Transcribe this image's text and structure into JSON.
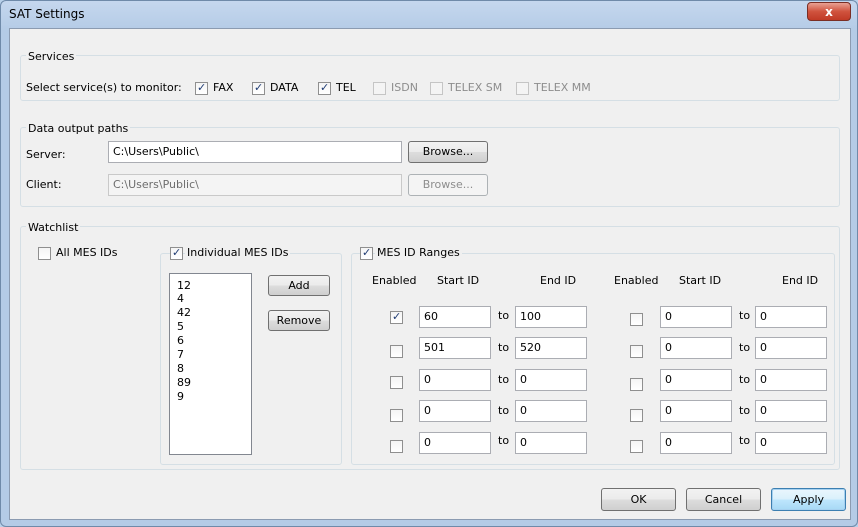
{
  "window": {
    "title": "SAT Settings",
    "close_glyph": "x"
  },
  "services": {
    "group_label": "Services",
    "select_label": "Select service(s) to monitor:",
    "items": [
      {
        "label": "FAX",
        "checked": true,
        "enabled": true
      },
      {
        "label": "DATA",
        "checked": true,
        "enabled": true
      },
      {
        "label": "TEL",
        "checked": true,
        "enabled": true
      },
      {
        "label": "ISDN",
        "checked": false,
        "enabled": false
      },
      {
        "label": "TELEX SM",
        "checked": false,
        "enabled": false
      },
      {
        "label": "TELEX MM",
        "checked": false,
        "enabled": false
      }
    ]
  },
  "paths": {
    "group_label": "Data output paths",
    "server_label": "Server:",
    "server_value": "C:\\Users\\Public\\",
    "client_label": "Client:",
    "client_value": "C:\\Users\\Public\\",
    "browse_label": "Browse..."
  },
  "watchlist": {
    "group_label": "Watchlist",
    "all_ids_label": "All MES IDs",
    "all_ids_checked": false,
    "individual_label": "Individual MES IDs",
    "individual_checked": true,
    "ids": [
      "12",
      "4",
      "42",
      "5",
      "6",
      "7",
      "8",
      "89",
      "9"
    ],
    "add_label": "Add",
    "remove_label": "Remove",
    "ranges_label": "MES ID Ranges",
    "ranges_checked": true,
    "col_enabled": "Enabled",
    "col_start": "Start ID",
    "col_end": "End ID",
    "to_label": "to",
    "left_ranges": [
      {
        "enabled": true,
        "start": "60",
        "end": "100"
      },
      {
        "enabled": false,
        "start": "501",
        "end": "520"
      },
      {
        "enabled": false,
        "start": "0",
        "end": "0"
      },
      {
        "enabled": false,
        "start": "0",
        "end": "0"
      },
      {
        "enabled": false,
        "start": "0",
        "end": "0"
      }
    ],
    "right_ranges": [
      {
        "enabled": false,
        "start": "0",
        "end": "0"
      },
      {
        "enabled": false,
        "start": "0",
        "end": "0"
      },
      {
        "enabled": false,
        "start": "0",
        "end": "0"
      },
      {
        "enabled": false,
        "start": "0",
        "end": "0"
      },
      {
        "enabled": false,
        "start": "0",
        "end": "0"
      }
    ]
  },
  "buttons": {
    "ok": "OK",
    "cancel": "Cancel",
    "apply": "Apply"
  }
}
